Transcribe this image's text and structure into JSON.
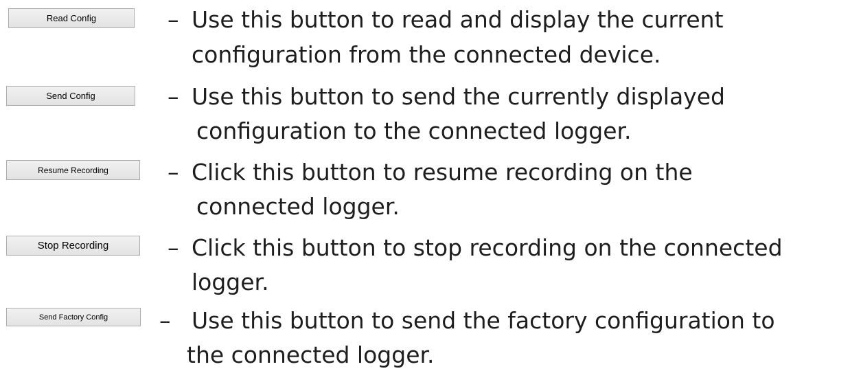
{
  "items": [
    {
      "button_label": "Read Config",
      "dash": "–",
      "line1": "Use this button to read and display the current",
      "line2": "configuration from the connected device."
    },
    {
      "button_label": "Send Config",
      "dash": "–",
      "line1": "Use this button to send the currently displayed",
      "line2": "configuration to the connected logger."
    },
    {
      "button_label": "Resume Recording",
      "dash": "–",
      "line1": "Click this button to resume recording on the",
      "line2": "connected logger."
    },
    {
      "button_label": "Stop Recording",
      "dash": "–",
      "line1": "Click this button to stop recording on the connected",
      "line2": "logger."
    },
    {
      "button_label": "Send Factory Config",
      "dash": "–",
      "line1": "Use this button to send the factory configuration to",
      "line2": "the connected logger."
    }
  ]
}
